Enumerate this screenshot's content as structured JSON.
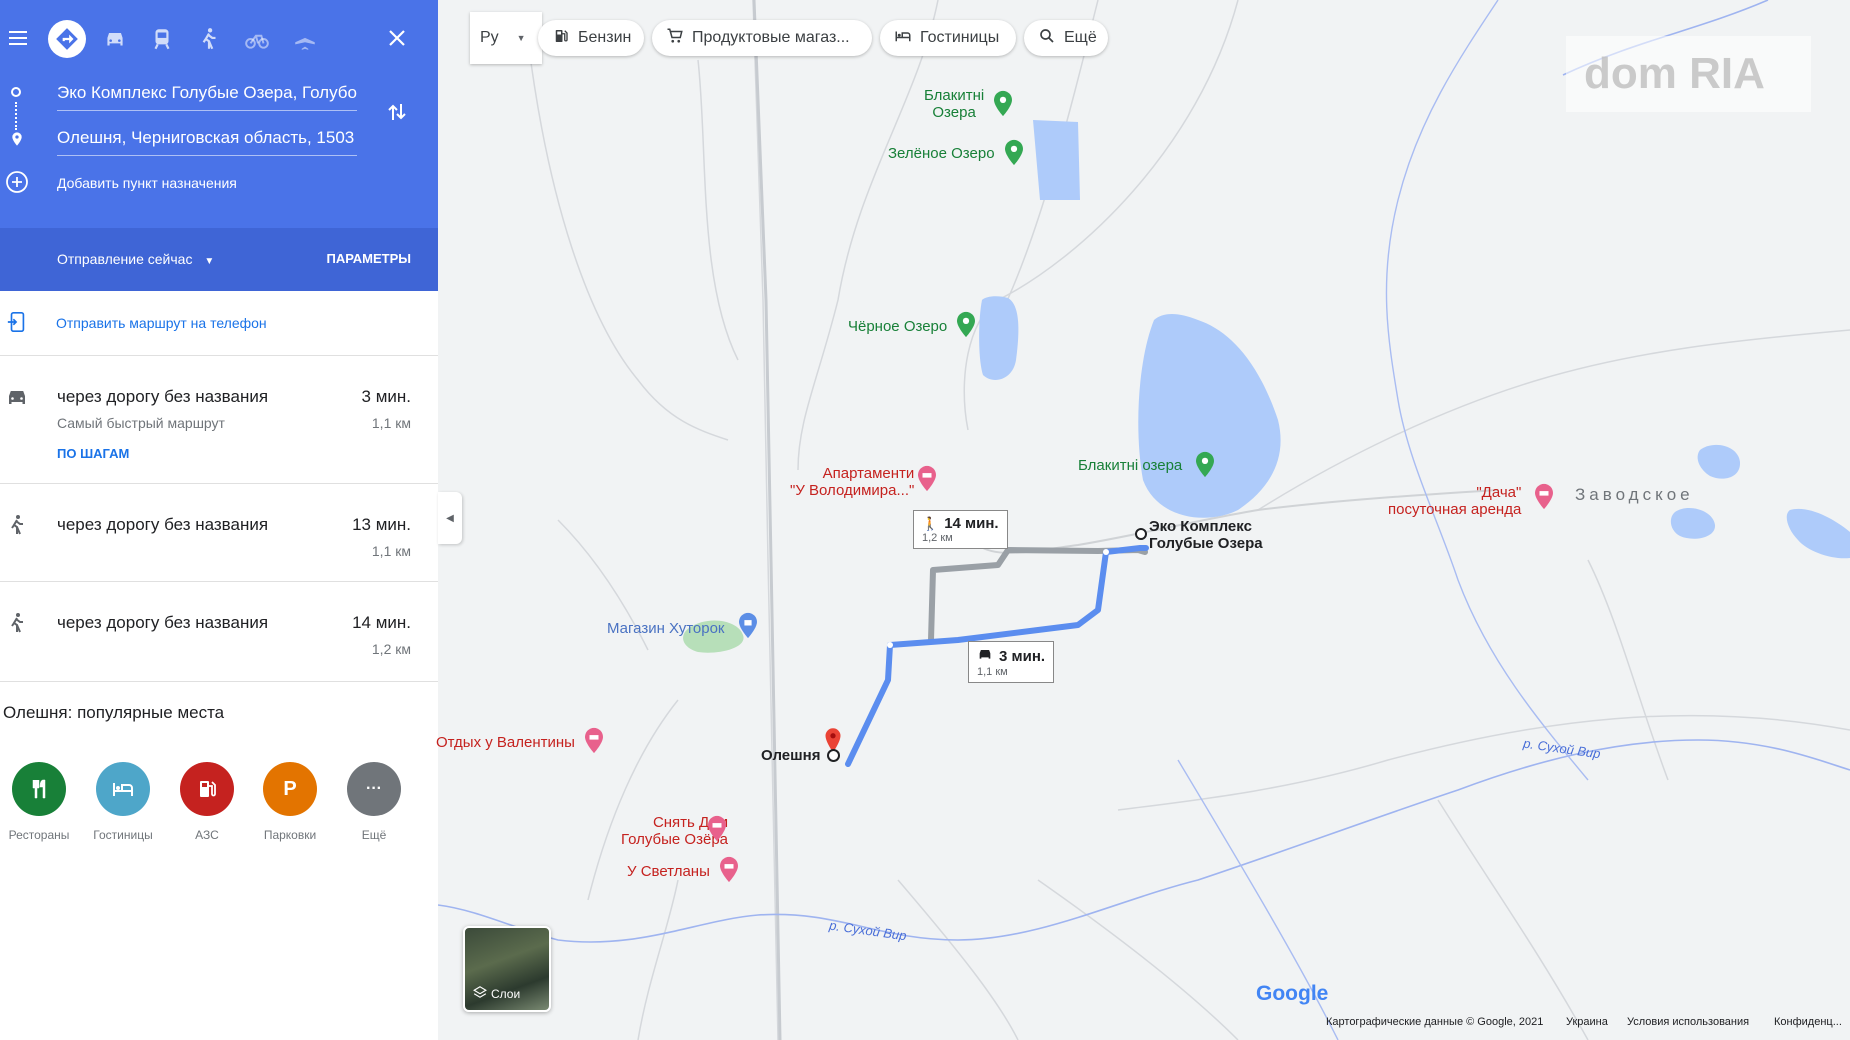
{
  "directions": {
    "origin": "Эко Комплекс Голубые Озера, Голубо",
    "destination": "Олешня, Черниговская область, 1503",
    "add_destination": "Добавить пункт назначения",
    "depart": "Отправление сейчас",
    "options": "ПАРАМЕТРЫ",
    "send_to_phone": "Отправить маршрут на телефон",
    "modes": [
      "directions-icon",
      "car-icon",
      "transit-icon",
      "walk-icon",
      "bike-icon",
      "flight-icon"
    ]
  },
  "routes": [
    {
      "via": "через дорогу без названия",
      "time": "3 мин.",
      "distance": "1,1 км",
      "sub": "Самый быстрый маршрут",
      "steps": "ПО ШАГАМ",
      "icon": "car-icon"
    },
    {
      "via": "через дорогу без названия",
      "time": "13 мин.",
      "distance": "1,1 км",
      "icon": "walk-icon"
    },
    {
      "via": "через дорогу без названия",
      "time": "14 мин.",
      "distance": "1,2 км",
      "icon": "walk-icon"
    }
  ],
  "popular": {
    "title": "Олешня: популярные места",
    "categories": [
      {
        "label": "Рестораны",
        "color": "#188038",
        "icon": "restaurant-icon"
      },
      {
        "label": "Гостиницы",
        "color": "#4ea6c9",
        "icon": "hotel-icon"
      },
      {
        "label": "АЗС",
        "color": "#c5221f",
        "icon": "fuel-icon"
      },
      {
        "label": "Парковки",
        "color": "#e37400",
        "icon": "parking-icon",
        "glyph": "P"
      },
      {
        "label": "Ещё",
        "color": "#70757a",
        "icon": "more-icon",
        "glyph": "···"
      }
    ]
  },
  "map": {
    "lang": "Ру",
    "chips": [
      "Бензин",
      "Продуктовые магаз...",
      "Гостиницы",
      "Ещё"
    ],
    "places": {
      "blakitni_ozera_top": [
        "Блакитні",
        "Озера"
      ],
      "zelenoe": "Зелёное Озеро",
      "chernoe": "Чёрное Озеро",
      "apartments": [
        "Апартаменти",
        "\"У Володимира...\""
      ],
      "blakitni_lake": "Блакитні озера",
      "dacha": [
        "\"Дача\"",
        "посуточная аренда"
      ],
      "zavodskoe": "Заводское",
      "eco": [
        "Эко Комплекс",
        "Голубые Озера"
      ],
      "magazin": "Магазин Хуторок",
      "otdyh": "Отдых у Валентины",
      "oleshnya": "Олешня",
      "snyat": [
        "Снять Дом",
        "Голубые Озёра"
      ],
      "svetlany": "У Светланы",
      "river1": "р. Сухой Вир",
      "river2": "р. Сухой Вир"
    },
    "walk_tooltip": {
      "time": "14 мин.",
      "distance": "1,2 км"
    },
    "car_tooltip": {
      "time": "3 мин.",
      "distance": "1,1 км"
    },
    "layers": "Слои",
    "google": "Google",
    "watermark": "dom RIA",
    "footer": [
      "Картографические данные © Google, 2021",
      "Украина",
      "Условия использования",
      "Конфиденц..."
    ]
  }
}
